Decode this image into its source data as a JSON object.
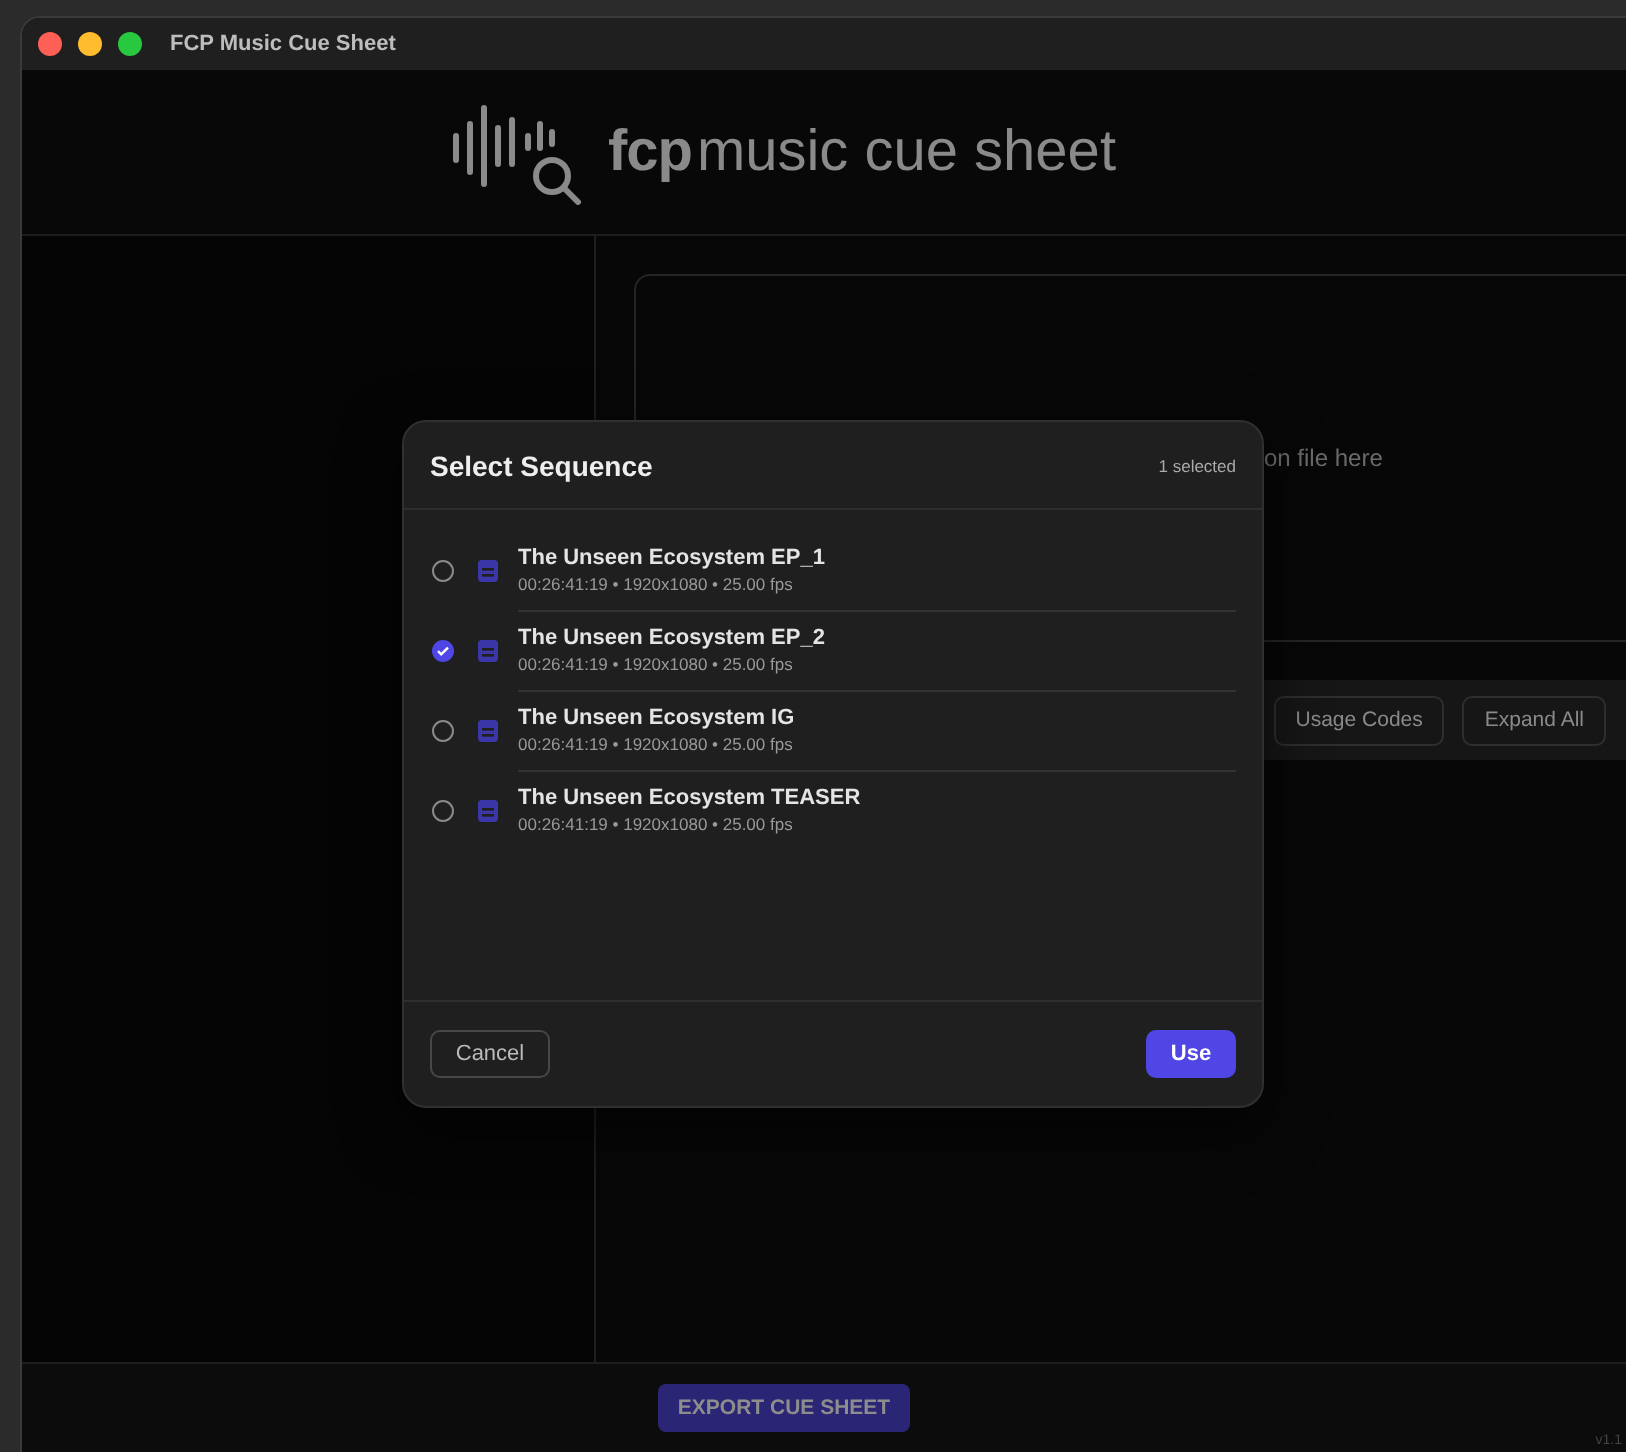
{
  "window": {
    "title": "FCP Music Cue Sheet"
  },
  "header": {
    "logo_bold": "fcp",
    "logo_text": "music cue sheet"
  },
  "drop_zone": {
    "text": "on file here"
  },
  "toolbar": {
    "buttons": [
      "Usage Codes",
      "Expand All"
    ]
  },
  "dialog": {
    "title": "Select Sequence",
    "count": "1 selected",
    "sequences": [
      {
        "name": "The Unseen Ecosystem EP_1",
        "details": "00:26:41:19 • 1920x1080 • 25.00 fps",
        "selected": false
      },
      {
        "name": "The Unseen Ecosystem EP_2",
        "details": "00:26:41:19 • 1920x1080 • 25.00 fps",
        "selected": true
      },
      {
        "name": "The Unseen Ecosystem IG",
        "details": "00:26:41:19 • 1920x1080 • 25.00 fps",
        "selected": false
      },
      {
        "name": "The Unseen Ecosystem TEASER",
        "details": "00:26:41:19 • 1920x1080 • 25.00 fps",
        "selected": false
      }
    ],
    "cancel": "Cancel",
    "confirm": "Use"
  },
  "footer": {
    "export_button": "EXPORT CUE SHEET",
    "version": "v1.1"
  }
}
